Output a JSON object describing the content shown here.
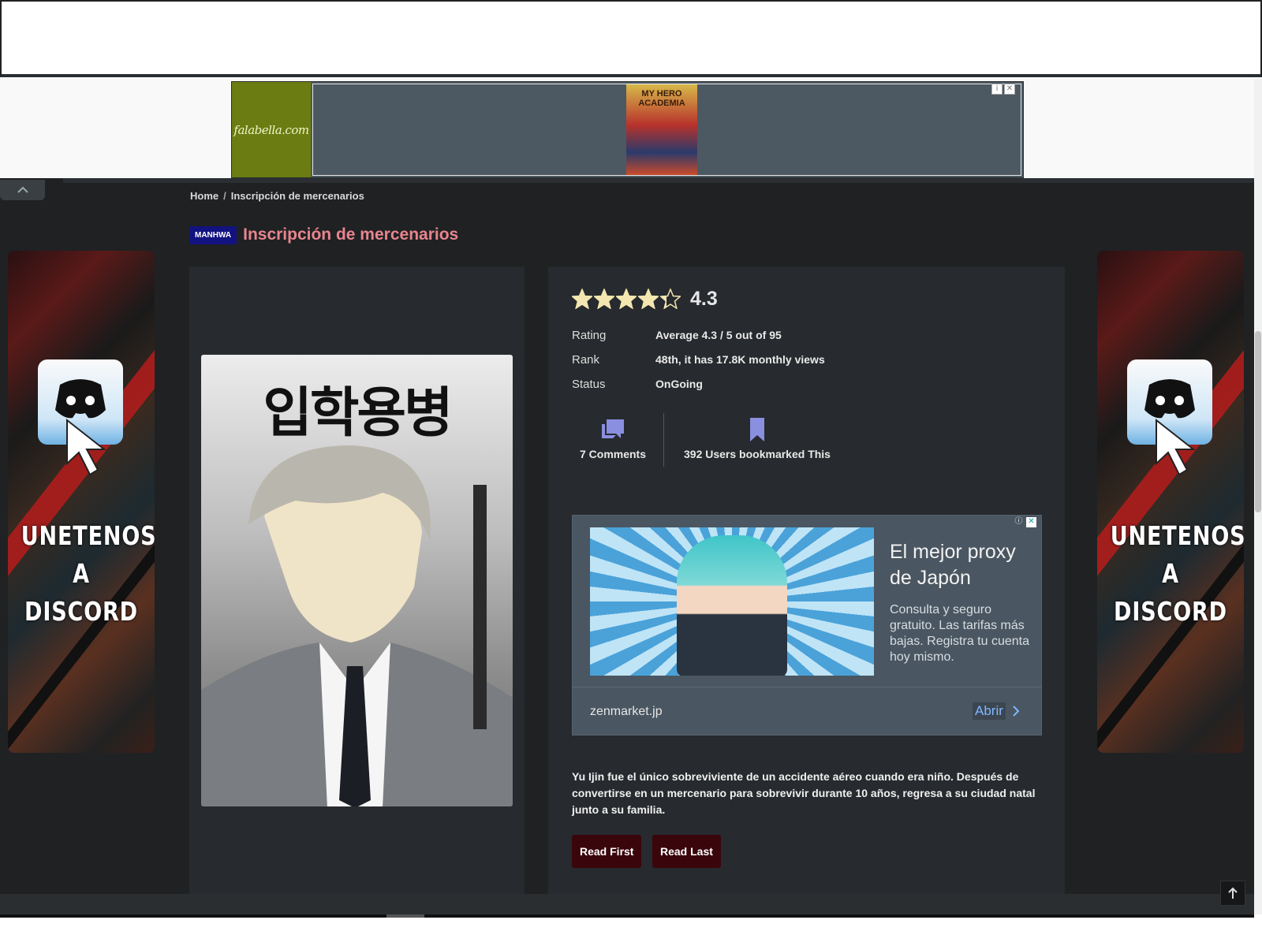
{
  "top_ad": {
    "advertiser_logo_text": "falabella.com",
    "book_title": "MY HERO ACADEMIA"
  },
  "breadcrumb": {
    "home": "Home",
    "separator": "/",
    "current": "Inscripción de mercenarios"
  },
  "series": {
    "type_badge": "MANHWA",
    "title": "Inscripción de mercenarios",
    "cover_title_korean": "입학용병",
    "rating_value": "4.3",
    "rating_stars": 4.3,
    "info": [
      {
        "key": "Rating",
        "value": "Average 4.3 / 5 out of 95"
      },
      {
        "key": "Rank",
        "value": "48th, it has 17.8K monthly views"
      },
      {
        "key": "Status",
        "value": "OnGoing"
      }
    ],
    "comments_label": "7 Comments",
    "bookmarks_label": "392 Users bookmarked This",
    "synopsis": "Yu Ijin fue el único sobreviviente de un accidente aéreo cuando era niño. Después de convertirse en un mercenario para sobrevivir durante 10 años, regresa a su ciudad natal junto a su familia.",
    "read_first": "Read First",
    "read_last": "Read Last"
  },
  "side_ads": {
    "text_line1": "UNETENOS A",
    "text_line2": "DISCORD"
  },
  "inline_ad": {
    "headline": "El mejor proxy de Japón",
    "body": "Consulta y seguro gratuito. Las tarifas más bajas. Registra tu cuenta hoy mismo.",
    "domain": "zenmarket.jp",
    "cta": "Abrir"
  },
  "colors": {
    "background": "#1f2123",
    "panel": "#272a2e",
    "title_accent": "#e8858e",
    "badge": "#121380",
    "button": "#3a060b",
    "icon_accent": "#8a8fe0"
  },
  "icons": [
    "chevron-up-icon",
    "star-icon",
    "comments-icon",
    "bookmark-icon",
    "discord-icon",
    "cursor-icon",
    "arrow-up-icon",
    "adchoices-icon",
    "close-icon",
    "chevron-right-icon"
  ]
}
